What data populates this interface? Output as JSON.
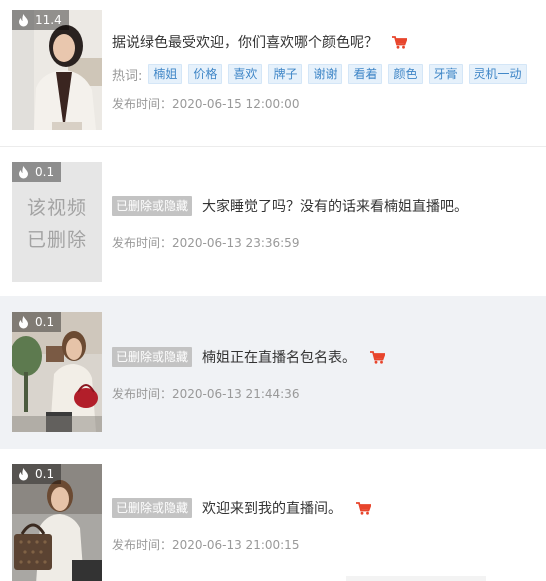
{
  "items": [
    {
      "heat": "11.4",
      "title": "据说绿色最受欢迎，你们喜欢哪个颜色呢？",
      "has_cart": true,
      "tags_label": "热词:",
      "tags": [
        "楠姐",
        "价格",
        "喜欢",
        "牌子",
        "谢谢",
        "看着",
        "颜色",
        "牙膏",
        "灵机一动"
      ],
      "time": "发布时间：2020-06-15 12:00:00"
    },
    {
      "heat": "0.1",
      "deleted_line1": "该视频",
      "deleted_line2": "已删除",
      "badge": "已删除或隐藏",
      "title": "大家睡觉了吗？没有的话来看楠姐直播吧。",
      "time": "发布时间：2020-06-13 23:36:59"
    },
    {
      "heat": "0.1",
      "badge": "已删除或隐藏",
      "title": "楠姐正在直播名包名表。",
      "has_cart": true,
      "time": "发布时间：2020-06-13 21:44:36"
    },
    {
      "heat": "0.1",
      "badge": "已删除或隐藏",
      "title": "欢迎来到我的直播间。",
      "has_cart": true,
      "time": "发布时间：2020-06-13 21:00:15"
    }
  ],
  "colors": {
    "cart": "#e8452c",
    "tag_text": "#3f86c7",
    "tag_bg": "#e6f1fb",
    "badge_bg": "#c3c3c3",
    "highlight_bg": "#f0f2f5"
  },
  "icons": {
    "heat": "flame-icon",
    "cart": "shopping-cart-icon"
  }
}
